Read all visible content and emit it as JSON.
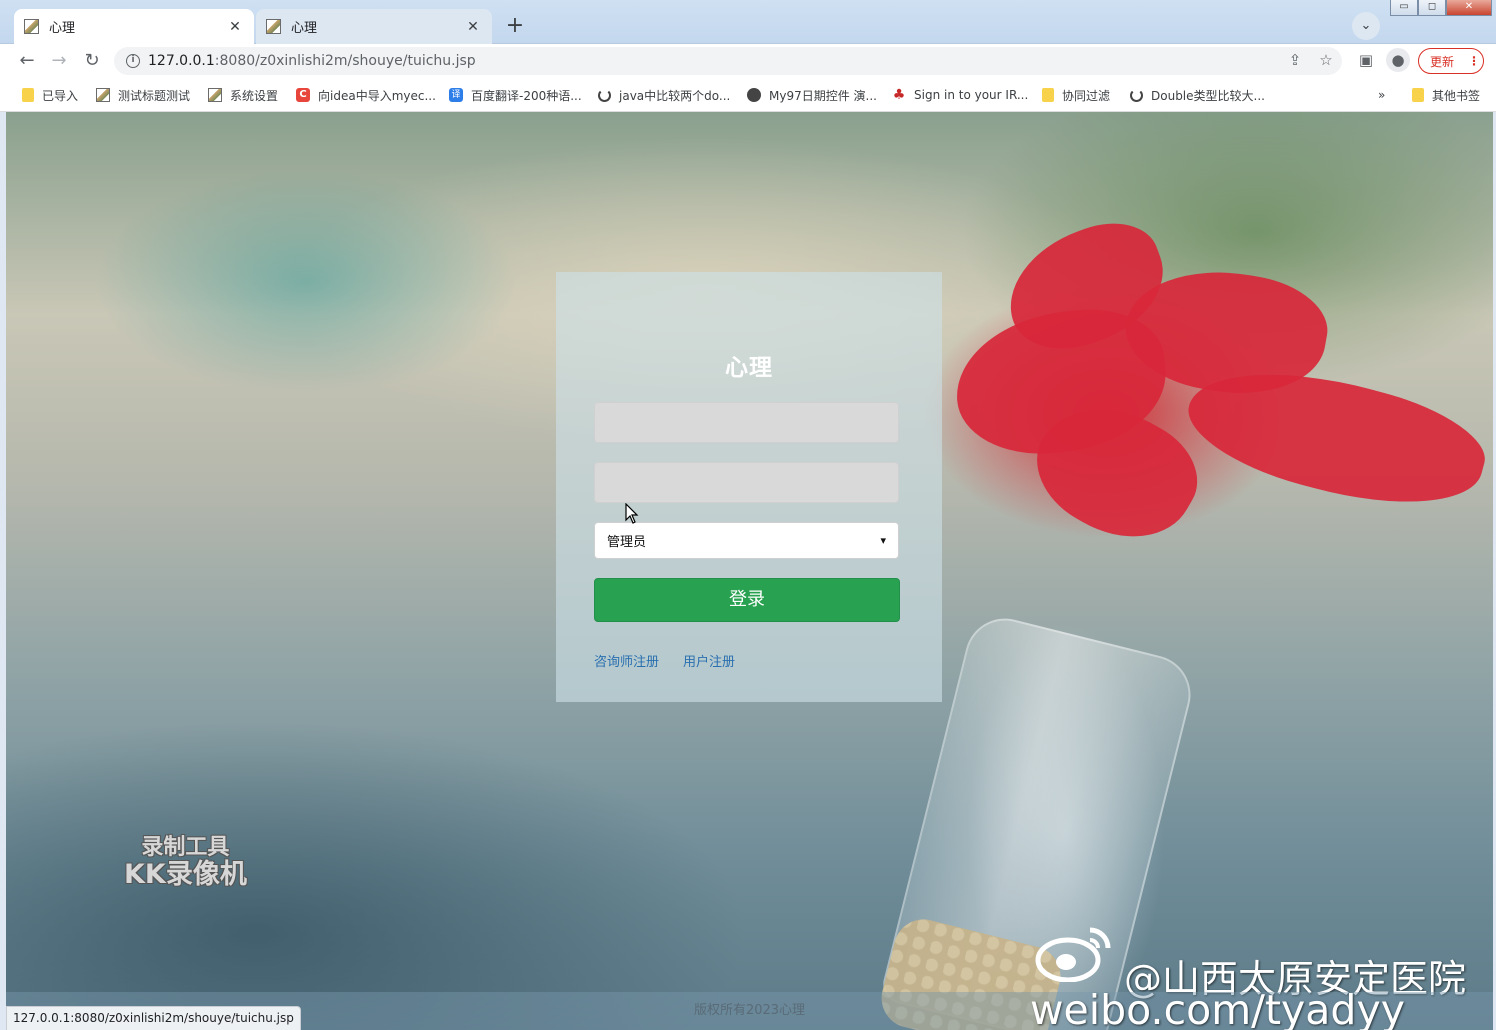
{
  "browser": {
    "tabs": [
      {
        "title": "心理",
        "active": true
      },
      {
        "title": "心理",
        "active": false
      }
    ],
    "address": {
      "host": "127.0.0.1",
      "rest": ":8080/z0xinlishi2m/shouye/tuichu.jsp"
    },
    "update_label": "更新",
    "bookmarks": [
      {
        "label": "已导入",
        "icon": "folder-icon"
      },
      {
        "label": "测试标题测试",
        "icon": "picture-icon"
      },
      {
        "label": "系统设置",
        "icon": "picture-icon"
      },
      {
        "label": "向idea中导入myec...",
        "icon": "c-logo-icon"
      },
      {
        "label": "百度翻译-200种语...",
        "icon": "translate-icon"
      },
      {
        "label": "java中比较两个do...",
        "icon": "swirl-icon"
      },
      {
        "label": "My97日期控件 演...",
        "icon": "globe-icon"
      },
      {
        "label": "Sign in to your IR...",
        "icon": "maple-leaf-icon"
      },
      {
        "label": "协同过滤",
        "icon": "folder-icon"
      },
      {
        "label": "Double类型比较大...",
        "icon": "swirl-icon"
      }
    ],
    "bookmarks_overflow": "»",
    "other_bookmarks": "其他书签",
    "status_url": "127.0.0.1:8080/z0xinlishi2m/shouye/tuichu.jsp"
  },
  "login": {
    "title": "心理",
    "username_value": "",
    "password_value": "",
    "role_selected": "管理员",
    "submit_label": "登录",
    "links": {
      "counselor_register": "咨询师注册",
      "user_register": "用户注册"
    }
  },
  "footer": {
    "copyright": "版权所有2023心理"
  },
  "watermarks": {
    "recorder_line1": "录制工具",
    "recorder_line2": "KK录像机",
    "weibo_name": "@山西太原安定医院",
    "weibo_url": "weibo.com/tyadyy"
  },
  "colors": {
    "login_button": "#28a150",
    "link": "#2a6fb0",
    "update_accent": "#d93025"
  }
}
